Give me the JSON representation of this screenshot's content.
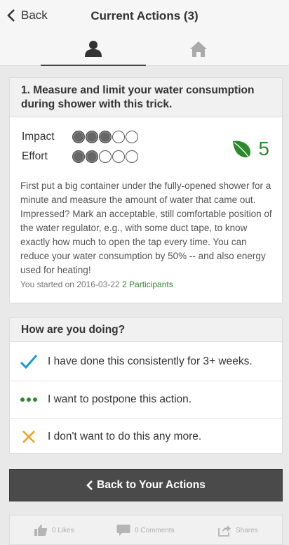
{
  "header": {
    "back_label": "Back",
    "title": "Current Actions (3)"
  },
  "tabs": [
    {
      "name": "profile",
      "icon": "person-icon",
      "active": true
    },
    {
      "name": "home",
      "icon": "home-icon",
      "active": false
    }
  ],
  "action": {
    "title": "1. Measure and limit your water consumption during shower with this trick.",
    "impact_label": "Impact",
    "impact_level": 3,
    "effort_label": "Effort",
    "effort_level": 2,
    "max_level": 5,
    "score": "5",
    "score_color": "#2c8a2c",
    "description": "First put a big container under the fully-opened shower for a minute and measure the amount of water that came out. Impressed? Mark an acceptable, still comfortable position of the water regulator, e.g., with some duct tape, to know exactly how much to open the tap every time. You can reduce your water consumption by 50% -- and also energy used for heating!",
    "started_text": "You started on 2016-03-22",
    "participants_text": "2 Participants"
  },
  "doing": {
    "header": "How are you doing?",
    "options": [
      {
        "icon": "checkmark-icon",
        "label": "I have done this consistently for 3+ weeks."
      },
      {
        "icon": "ellipsis-icon",
        "label": "I want to postpone this action."
      },
      {
        "icon": "x-icon",
        "label": "I don't want to do this any more."
      }
    ]
  },
  "back_to_actions_label": "Back to Your Actions",
  "social": {
    "likes": "0 Likes",
    "comments": "0 Comments",
    "shares": "Shares"
  },
  "colors": {
    "green": "#2c8a2c",
    "check_blue": "#1a9ad6",
    "x_orange": "#f0a020",
    "button_dark": "#4a4a4a"
  }
}
